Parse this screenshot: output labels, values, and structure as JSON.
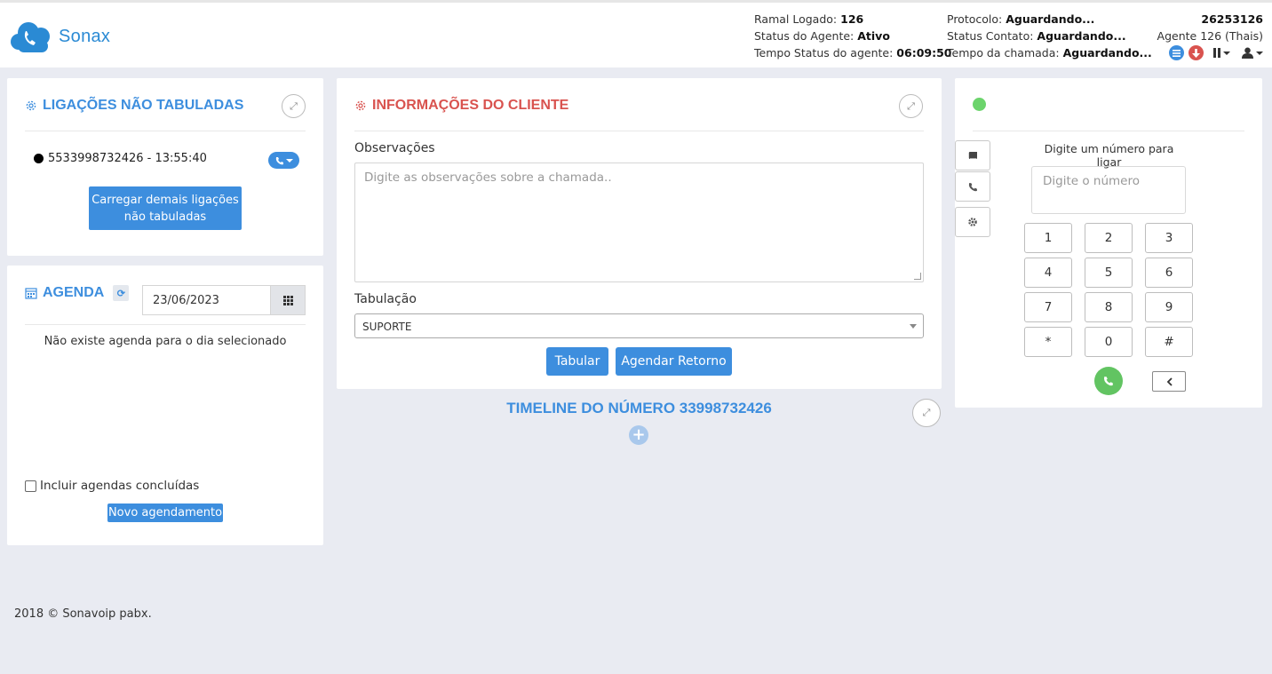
{
  "header": {
    "logo_text": "Sonax",
    "ramal_label": "Ramal Logado:",
    "ramal_value": "126",
    "status_agente_label": "Status do Agente:",
    "status_agente_value": "Ativo",
    "tempo_status_label": "Tempo Status do agente:",
    "tempo_status_value": "06:09:50",
    "protocolo_label": "Protocolo:",
    "protocolo_value": "Aguardando...",
    "status_contato_label": "Status Contato:",
    "status_contato_value": "Aguardando...",
    "tempo_chamada_label": "Tempo da chamada:",
    "tempo_chamada_value": "Aguardando...",
    "account_number": "26253126",
    "agent_name": "Agente 126 (Thais)",
    "icons": [
      "list-icon",
      "download-icon",
      "pause-icon",
      "user-icon"
    ],
    "brand_color": "#2a8ad4"
  },
  "ligacoes": {
    "title": "LIGAÇÕES NÃO TABULADAS",
    "calls": [
      {
        "text": "5533998732426 - 13:55:40"
      }
    ],
    "load_more_label": "Carregar demais ligações não tabuladas"
  },
  "agenda": {
    "title": "AGENDA",
    "date_value": "23/06/2023",
    "empty_message": "Não existe agenda para o dia selecionado",
    "include_completed_label": "Incluir agendas concluídas",
    "include_completed_checked": false,
    "new_schedule_label": "Novo agendamento"
  },
  "cliente": {
    "title": "INFORMAÇÕES DO CLIENTE",
    "observacoes_label": "Observações",
    "observacoes_placeholder": "Digite as observações sobre a chamada..",
    "observacoes_value": "",
    "tabulacao_label": "Tabulação",
    "tabulacao_selected": "SUPORTE",
    "tabular_label": "Tabular",
    "agendar_label": "Agendar Retorno"
  },
  "timeline": {
    "title": "TIMELINE DO NÚMERO 33998732426"
  },
  "dialer": {
    "status_color": "#6cd46c",
    "prompt": "Digite um número para ligar",
    "input_placeholder": "Digite o número",
    "keys": [
      "1",
      "2",
      "3",
      "4",
      "5",
      "6",
      "7",
      "8",
      "9",
      "*",
      "0",
      "#"
    ],
    "side_icons": [
      "book-icon",
      "phone-icon",
      "gear-icon"
    ]
  },
  "footer": {
    "text": "2018 © Sonavoip pabx."
  },
  "colors": {
    "accent_blue": "#3d8ede",
    "accent_red": "#d9534f",
    "background": "#e9ebf2"
  }
}
